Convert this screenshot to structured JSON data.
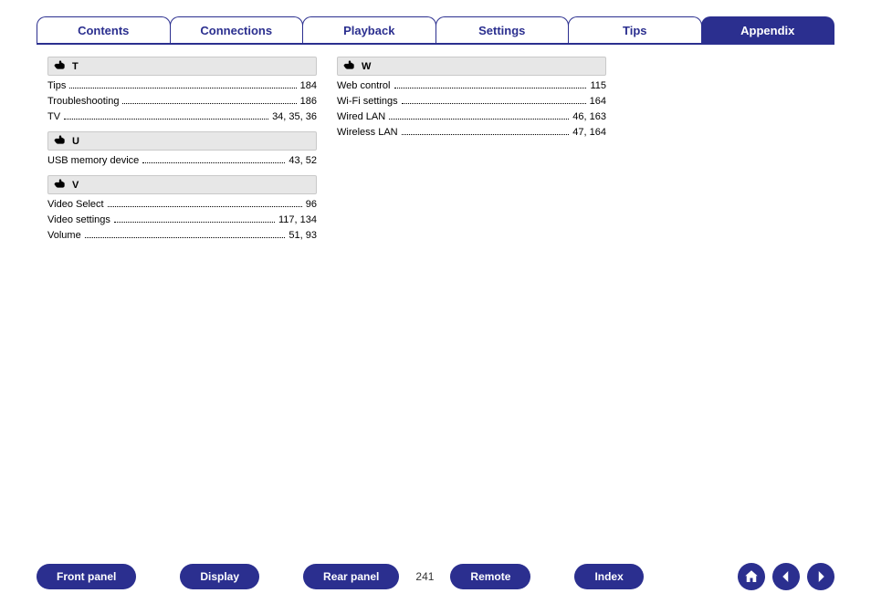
{
  "tabs": [
    {
      "label": "Contents",
      "active": false
    },
    {
      "label": "Connections",
      "active": false
    },
    {
      "label": "Playback",
      "active": false
    },
    {
      "label": "Settings",
      "active": false
    },
    {
      "label": "Tips",
      "active": false
    },
    {
      "label": "Appendix",
      "active": true
    }
  ],
  "page_number": "241",
  "bottom_buttons": [
    "Front panel",
    "Display",
    "Rear panel",
    "Remote",
    "Index"
  ],
  "columns": [
    [
      {
        "letter": "T",
        "rows": [
          {
            "term": "Tips",
            "pages": "184"
          },
          {
            "term": "Troubleshooting",
            "pages": "186"
          },
          {
            "term": "TV",
            "pages": "34, 35, 36"
          }
        ]
      },
      {
        "letter": "U",
        "rows": [
          {
            "term": "USB memory device",
            "pages": "43, 52"
          }
        ]
      },
      {
        "letter": "V",
        "rows": [
          {
            "term": "Video Select",
            "pages": "96"
          },
          {
            "term": "Video settings",
            "pages": "117, 134"
          },
          {
            "term": "Volume",
            "pages": "51, 93"
          }
        ]
      }
    ],
    [
      {
        "letter": "W",
        "rows": [
          {
            "term": "Web control",
            "pages": "115"
          },
          {
            "term": "Wi-Fi settings",
            "pages": "164"
          },
          {
            "term": "Wired LAN",
            "pages": "46, 163"
          },
          {
            "term": "Wireless LAN",
            "pages": "47, 164"
          }
        ]
      }
    ]
  ]
}
